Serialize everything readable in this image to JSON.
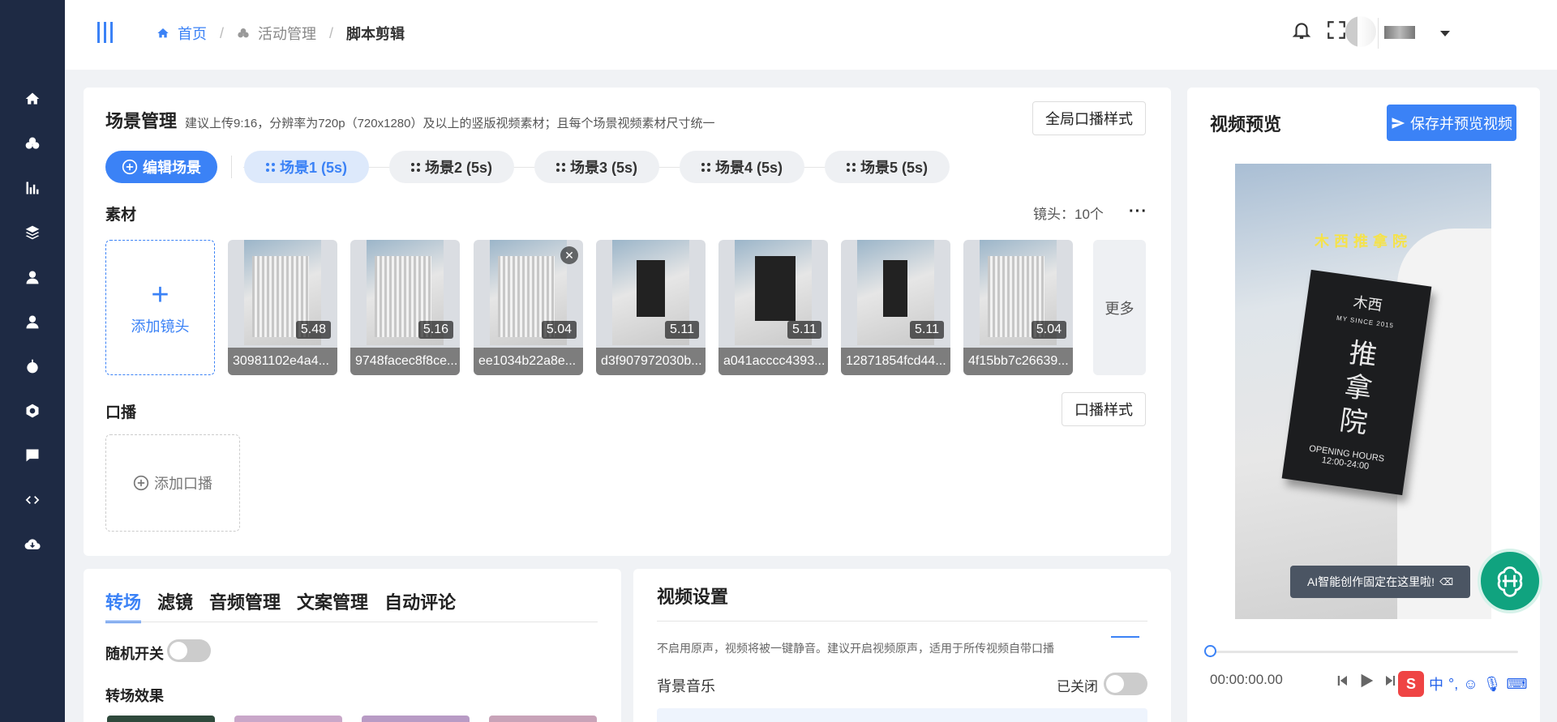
{
  "breadcrumb": {
    "home": "首页",
    "activity": "活动管理",
    "current": "脚本剪辑"
  },
  "scene": {
    "title": "场景管理",
    "hint": "建议上传9:16，分辨率为720p（720x1280）及以上的竖版视频素材；且每个场景视频素材尺寸统一",
    "global_btn": "全局口播样式",
    "edit_btn": "编辑场景",
    "pills": [
      "场景1 (5s)",
      "场景2 (5s)",
      "场景3 (5s)",
      "场景4 (5s)",
      "场景5 (5s)"
    ],
    "material_label": "素材",
    "shot_count": "镜头：10个",
    "add_shot": "添加镜头",
    "more": "更多",
    "thumbs": [
      {
        "name": "30981102e4a4...",
        "dur": "5.48"
      },
      {
        "name": "9748facec8f8ce...",
        "dur": "5.16"
      },
      {
        "name": "ee1034b22a8e...",
        "dur": "5.04"
      },
      {
        "name": "d3f907972030b...",
        "dur": "5.11"
      },
      {
        "name": "a041acccc4393...",
        "dur": "5.11"
      },
      {
        "name": "12871854fcd44...",
        "dur": "5.11"
      },
      {
        "name": "4f15bb7c26639...",
        "dur": "5.04"
      }
    ],
    "voice_label": "口播",
    "voice_style_btn": "口播样式",
    "add_voice": "添加口播"
  },
  "tabs": [
    "转场",
    "滤镜",
    "音频管理",
    "文案管理",
    "自动评论"
  ],
  "transition": {
    "random_label": "随机开关",
    "effects_label": "转场效果"
  },
  "video_settings": {
    "title": "视频设置",
    "note": "不启用原声，视频将被一键静音。建议开启视频原声，适用于所传视频自带口播",
    "bgm_label": "背景音乐",
    "bgm_state": "已关闭"
  },
  "preview": {
    "title": "视频预览",
    "save_btn": "保存并预览视频",
    "sign_top": "木西推拿院",
    "sign_brand": "木西",
    "sign_since": "MY SINCE 2015",
    "sign_main": "推拿院",
    "sign_hours_label": "OPENING HOURS",
    "sign_hours": "12:00-24:00",
    "time": "00:00:00.00",
    "ai_tip": "AI智能创作固定在这里啦!",
    "ime": "中"
  },
  "colors": {
    "primary": "#3b82f6",
    "sidebar": "#1e2a44"
  }
}
